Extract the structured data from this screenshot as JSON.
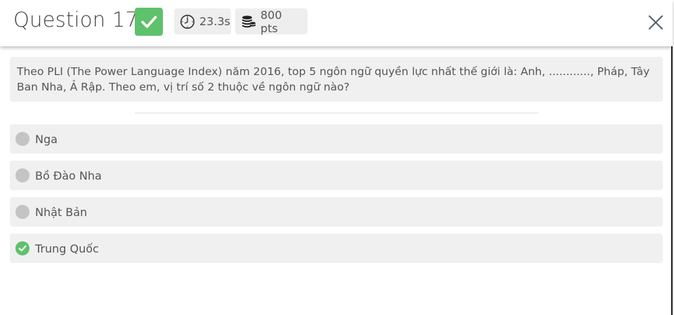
{
  "header": {
    "question_title": "Question 17",
    "time": "23.3s",
    "points": "800 pts",
    "result_icon": "check-icon",
    "time_icon": "clock-icon",
    "points_icon": "coins-icon",
    "close_icon": "close-icon"
  },
  "question": {
    "text": "Theo PLI (The Power Language Index) năm 2016, top 5 ngôn ngữ quyền lực nhất thế giới là: Anh, ............, Pháp, Tây Ban Nha, Ả Rập. Theo em, vị trí số 2 thuộc về ngôn ngữ nào?"
  },
  "options": [
    {
      "label": "Nga",
      "status": "unselected"
    },
    {
      "label": "Bồ Đào Nha",
      "status": "unselected"
    },
    {
      "label": "Nhật Bản",
      "status": "unselected"
    },
    {
      "label": "Trung Quốc",
      "status": "correct"
    }
  ],
  "colors": {
    "correct": "#5ec16b",
    "neutral_mark": "#c4c4c4",
    "card_bg": "#f0f0f0"
  }
}
